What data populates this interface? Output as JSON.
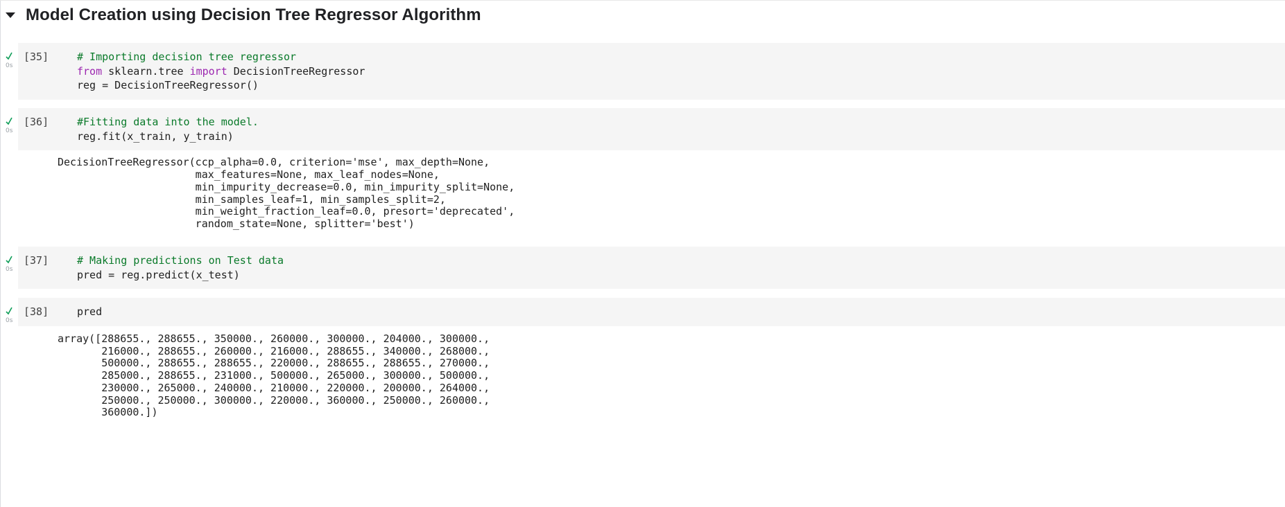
{
  "section": {
    "title": "Model Creation using Decision Tree Regressor Algorithm"
  },
  "icons": {
    "collapse": "caret-down-icon",
    "status": "check-icon"
  },
  "colors": {
    "cell_background": "#f5f5f5",
    "comment": "#0a7a2a",
    "keyword": "#9c27b0",
    "success_check": "#0f9d58",
    "exec_time": "#9aa0a6"
  },
  "cells": [
    {
      "count": "[35]",
      "exec_time": "0s",
      "code": {
        "line1_comment": "# Importing decision tree regressor",
        "line2_kw_from": "from",
        "line2_module": " sklearn.tree ",
        "line2_kw_import": "import",
        "line2_name": " DecisionTreeRegressor",
        "line3": "reg = DecisionTreeRegressor()"
      }
    },
    {
      "count": "[36]",
      "exec_time": "0s",
      "code": {
        "line1_comment": "#Fitting data into the model.",
        "line2": "reg.fit(x_train, y_train)"
      },
      "output": [
        "DecisionTreeRegressor(ccp_alpha=0.0, criterion='mse', max_depth=None,",
        "                      max_features=None, max_leaf_nodes=None,",
        "                      min_impurity_decrease=0.0, min_impurity_split=None,",
        "                      min_samples_leaf=1, min_samples_split=2,",
        "                      min_weight_fraction_leaf=0.0, presort='deprecated',",
        "                      random_state=None, splitter='best')"
      ]
    },
    {
      "count": "[37]",
      "exec_time": "0s",
      "code": {
        "line1_comment": "# Making predictions on Test data",
        "line2": "pred = reg.predict(x_test)"
      }
    },
    {
      "count": "[38]",
      "exec_time": "0s",
      "code": {
        "line1": "pred"
      },
      "output": [
        "array([288655., 288655., 350000., 260000., 300000., 204000., 300000.,",
        "       216000., 288655., 260000., 216000., 288655., 340000., 268000.,",
        "       500000., 288655., 288655., 220000., 288655., 288655., 270000.,",
        "       285000., 288655., 231000., 500000., 265000., 300000., 500000.,",
        "       230000., 265000., 240000., 210000., 220000., 200000., 264000.,",
        "       250000., 250000., 300000., 220000., 360000., 250000., 260000.,",
        "       360000.])"
      ]
    }
  ]
}
